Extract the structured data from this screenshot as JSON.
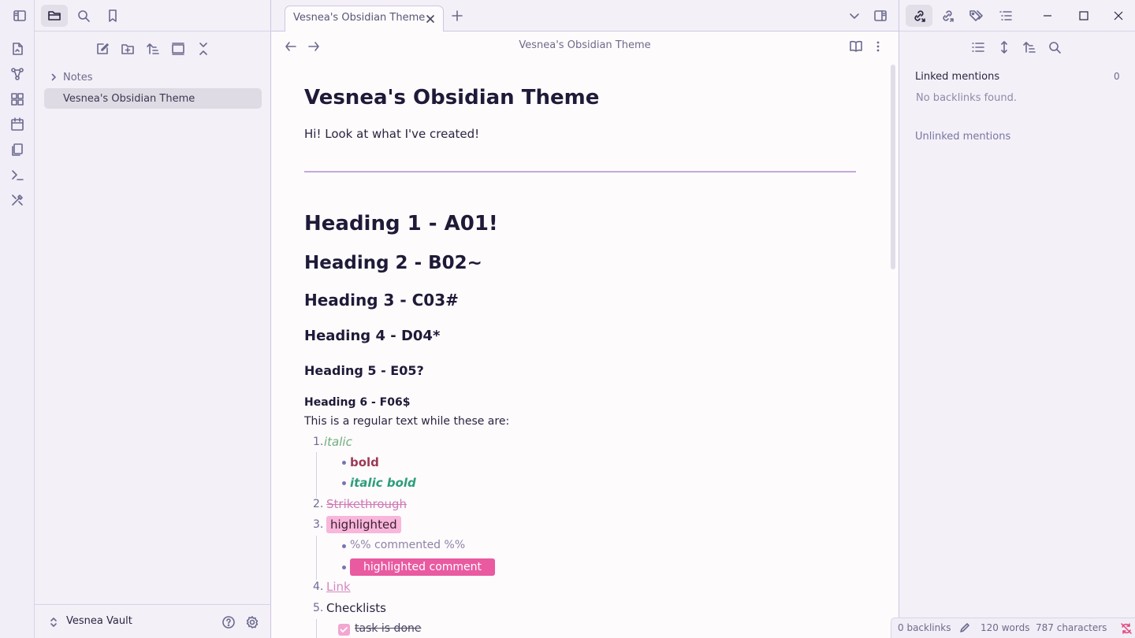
{
  "left_sidebar": {
    "tree": {
      "folder": "Notes",
      "file": "Vesnea's Obsidian Theme"
    },
    "vault_name": "Vesnea Vault"
  },
  "tab": {
    "title": "Vesnea's Obsidian Theme"
  },
  "view_header": {
    "title": "Vesnea's Obsidian Theme"
  },
  "note": {
    "title": "Vesnea's Obsidian Theme",
    "intro": "Hi! Look at what I've created!",
    "h1": "Heading 1 - A01!",
    "h2": "Heading 2 - B02~",
    "h3": "Heading 3 - C03#",
    "h4": "Heading 4 - D04*",
    "h5": "Heading 5 - E05?",
    "h6": "Heading 6 - F06$",
    "regular": "This is a regular text while these are:",
    "list": {
      "n1": "1.",
      "n2": "2.",
      "n3": "3.",
      "n4": "4.",
      "n5": "5.",
      "italic": "italic",
      "bold": "bold",
      "italic_bold": "italic bold",
      "strikethrough": "Strikethrough",
      "highlighted": "highlighted",
      "comment": "%% commented %%",
      "highlighted_comment": "highlighted comment",
      "link": "Link",
      "checklists": "Checklists",
      "task_done": "task is done"
    }
  },
  "right_sidebar": {
    "linked_mentions": "Linked mentions",
    "linked_count": "0",
    "no_backlinks": "No backlinks found.",
    "unlinked_mentions": "Unlinked mentions"
  },
  "status_bar": {
    "backlinks": "0 backlinks",
    "words": "120 words",
    "characters": "787 characters"
  },
  "colors": {
    "accent": "#7c73b0",
    "highlight": "#f8b6da",
    "highlighted_comment": "#e95aa1",
    "italic": "#6fae7b",
    "bold": "#9b3a55",
    "italic_bold": "#2e9d7b",
    "link": "#d688c0"
  }
}
